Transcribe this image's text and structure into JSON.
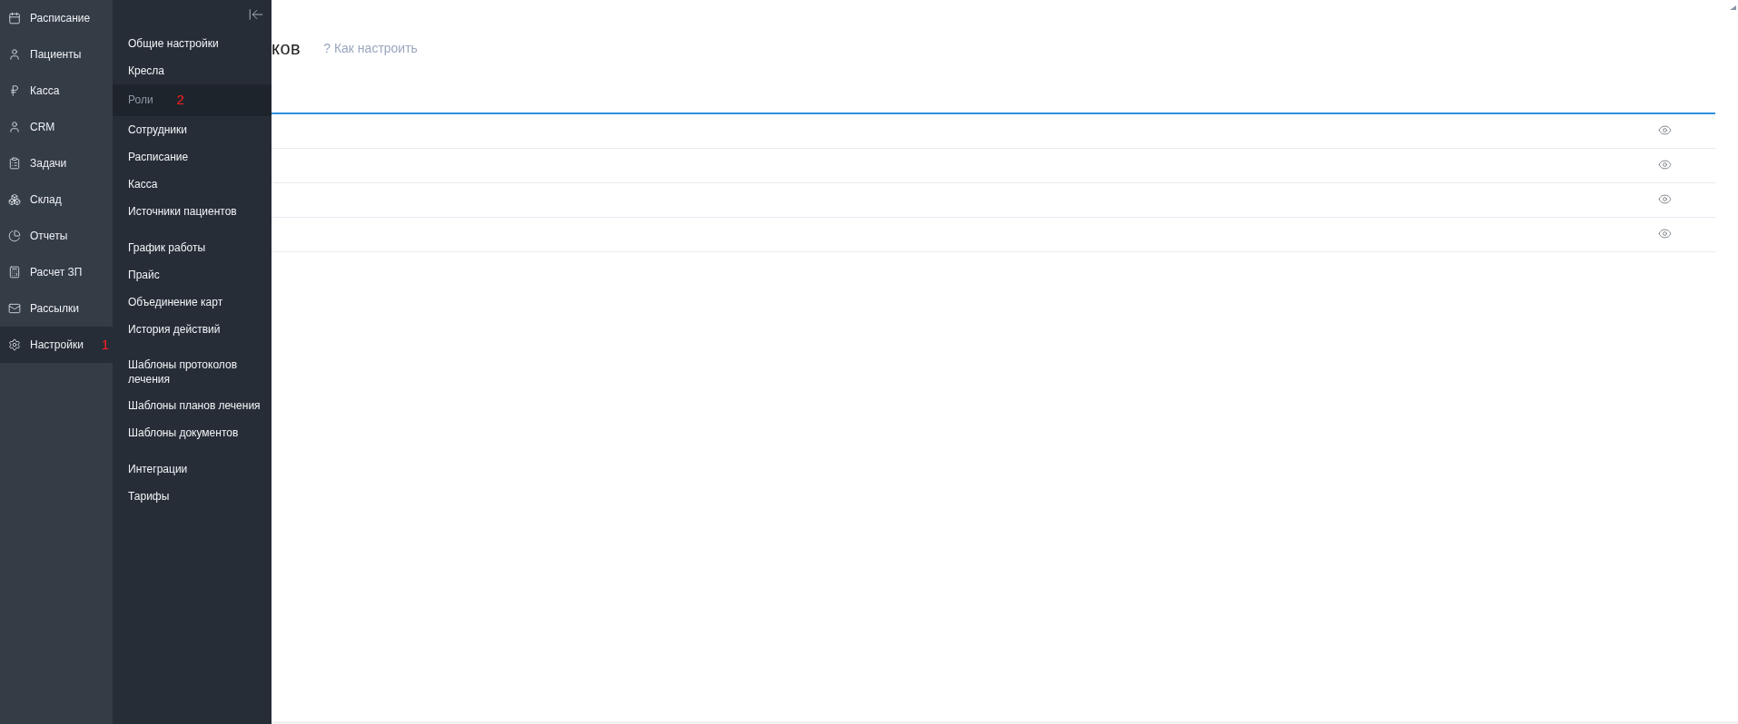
{
  "nav": {
    "items": [
      {
        "label": "Расписание",
        "selected": false
      },
      {
        "label": "Пациенты",
        "selected": false
      },
      {
        "label": "Касса",
        "selected": false
      },
      {
        "label": "CRM",
        "selected": false
      },
      {
        "label": "Задачи",
        "selected": false
      },
      {
        "label": "Склад",
        "selected": false
      },
      {
        "label": "Отчеты",
        "selected": false
      },
      {
        "label": "Расчет ЗП",
        "selected": false
      },
      {
        "label": "Рассылки",
        "selected": false
      },
      {
        "label": "Настройки",
        "selected": true,
        "annotation": "1"
      }
    ]
  },
  "submenu": {
    "groups": [
      [
        {
          "label": "Общие настройки",
          "selected": false
        },
        {
          "label": "Кресла",
          "selected": false
        },
        {
          "label": "Роли",
          "selected": true,
          "annotation": "2"
        },
        {
          "label": "Сотрудники",
          "selected": false
        },
        {
          "label": "Расписание",
          "selected": false
        },
        {
          "label": "Касса",
          "selected": false
        },
        {
          "label": "Источники пациентов",
          "selected": false
        }
      ],
      [
        {
          "label": "График работы",
          "selected": false
        },
        {
          "label": "Прайс",
          "selected": false
        },
        {
          "label": "Объединение карт",
          "selected": false
        },
        {
          "label": "История действий",
          "selected": false
        }
      ],
      [
        {
          "label": "Шаблоны протоколов лечения",
          "selected": false
        },
        {
          "label": "Шаблоны планов лечения",
          "selected": false
        },
        {
          "label": "Шаблоны документов",
          "selected": false
        }
      ],
      [
        {
          "label": "Интеграции",
          "selected": false
        },
        {
          "label": "Тарифы",
          "selected": false
        }
      ]
    ]
  },
  "page": {
    "title": "ков",
    "help_link": "? Как настроить"
  },
  "table": {
    "rows": [
      {
        "kind": "view"
      },
      {
        "kind": "view"
      },
      {
        "kind": "view"
      },
      {
        "kind": "view"
      }
    ]
  }
}
